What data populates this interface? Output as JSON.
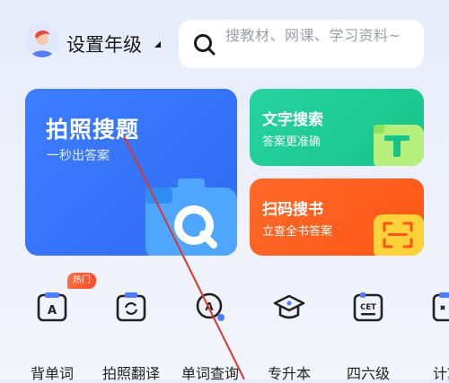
{
  "header": {
    "grade_label": "设置年级",
    "search_placeholder": "搜教材、网课、学习资料~"
  },
  "cards": {
    "photo_search": {
      "title": "拍照搜题",
      "subtitle": "一秒出答案"
    },
    "text_search": {
      "title": "文字搜索",
      "subtitle": "答案更准确"
    },
    "scan_book": {
      "title": "扫码搜书",
      "subtitle": "立查全书答案"
    }
  },
  "tools": [
    {
      "label": "背单词",
      "icon": "word-card-icon",
      "badge": "热门"
    },
    {
      "label": "拍照翻译",
      "icon": "photo-translate-icon"
    },
    {
      "label": "单词查询",
      "icon": "word-lookup-icon"
    },
    {
      "label": "专升本",
      "icon": "graduation-cap-icon"
    },
    {
      "label": "四六级",
      "icon": "cet-icon"
    },
    {
      "label": "计算",
      "icon": "calculator-icon"
    }
  ],
  "colors": {
    "photo_card": "#2f6bf5",
    "text_card": "#16c48a",
    "scan_card": "#ff5414",
    "hot_badge": "#ff4b2b",
    "annotation_line": "#e0342a"
  }
}
